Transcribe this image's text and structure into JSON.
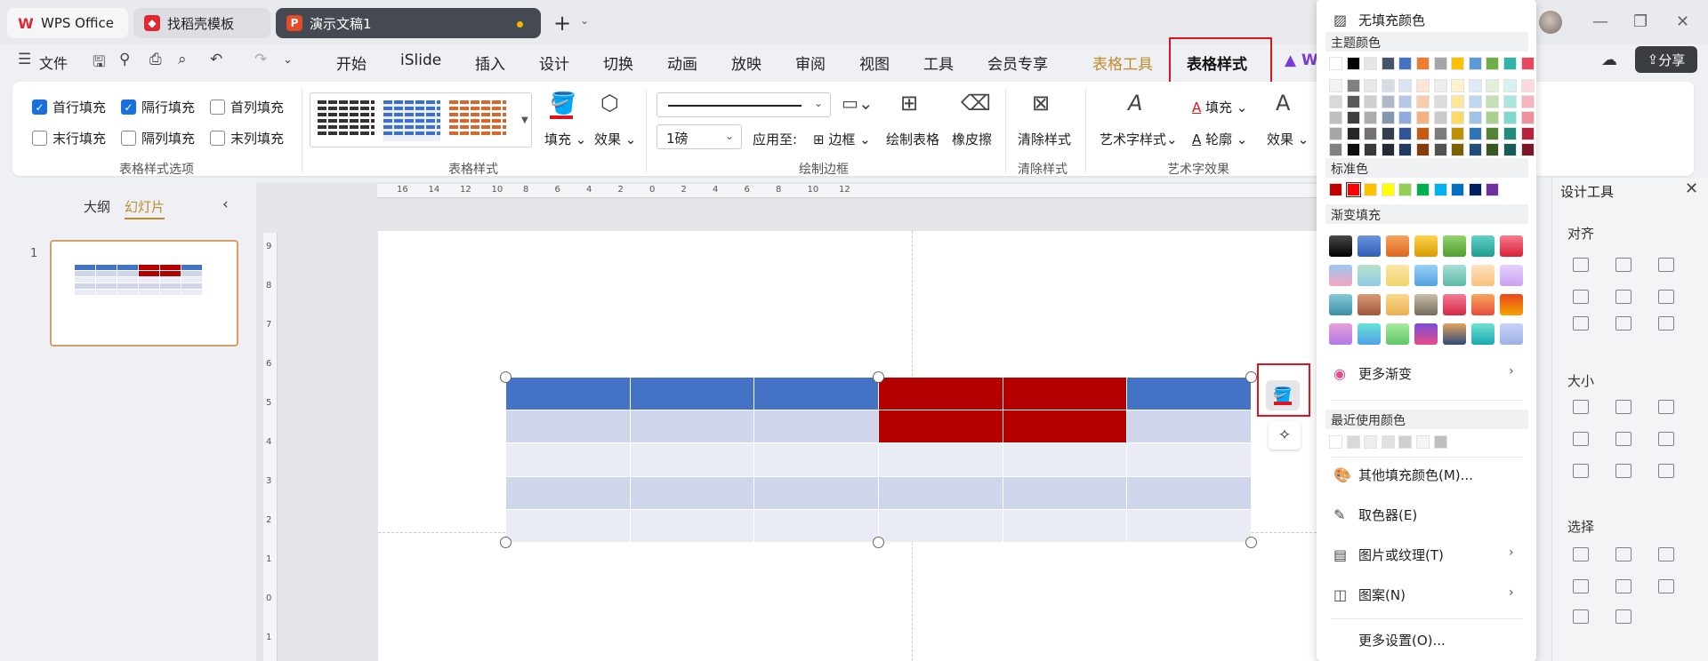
{
  "tabs": [
    {
      "label": "WPS Office",
      "icon": "wps-logo-icon"
    },
    {
      "label": "找稻壳模板",
      "icon": "docer-icon"
    },
    {
      "label": "演示文稿1",
      "icon": "presentation-icon",
      "active": true
    }
  ],
  "menu": {
    "file": "文件",
    "items": [
      "开始",
      "iSlide",
      "插入",
      "设计",
      "切换",
      "动画",
      "放映",
      "审阅",
      "视图",
      "工具",
      "会员专享",
      "表格工具",
      "表格样式",
      "W"
    ],
    "share": "分享"
  },
  "ribbon": {
    "options": {
      "first_row": "首行填充",
      "banded_rows": "隔行填充",
      "first_col": "首列填充",
      "last_row": "末行填充",
      "banded_cols": "隔列填充",
      "last_col": "末列填充",
      "first_row_checked": true,
      "banded_rows_checked": true,
      "group_label": "表格样式选项"
    },
    "styles": {
      "fill": "填充",
      "effect": "效果",
      "group_label": "表格样式"
    },
    "border": {
      "weight": "1磅",
      "apply_to": "应用至:",
      "border_btn": "边框",
      "draw_table": "绘制表格",
      "eraser": "橡皮擦",
      "group_label": "绘制边框"
    },
    "clear": {
      "clear_style": "清除样式",
      "group_label": "清除样式"
    },
    "art": {
      "art_style": "艺术字样式",
      "fill": "填充",
      "outline": "轮廓",
      "effect": "效果",
      "group_label": "艺术字效果"
    }
  },
  "left_panel": {
    "outline": "大纲",
    "slides": "幻灯片",
    "slide_number": "1"
  },
  "ruler": {
    "h_ticks": [
      "16",
      "14",
      "12",
      "10",
      "8",
      "6",
      "4",
      "2",
      "0",
      "2",
      "4",
      "6",
      "8",
      "10",
      "12"
    ],
    "v_ticks": [
      "9",
      "8",
      "7",
      "6",
      "5",
      "4",
      "3",
      "2",
      "1",
      "0",
      "1"
    ]
  },
  "table": {
    "rows": [
      [
        "#4472c4",
        "#4472c4",
        "#4472c4",
        "#b50000",
        "#b50000",
        "#4472c4"
      ],
      [
        "#cfd5ea",
        "#cfd5ea",
        "#cfd5ea",
        "#b50000",
        "#b50000",
        "#cfd5ea"
      ],
      [
        "#e9ebf5",
        "#e9ebf5",
        "#e9ebf5",
        "#e9ebf5",
        "#e9ebf5",
        "#e9ebf5"
      ],
      [
        "#cfd5ea",
        "#cfd5ea",
        "#cfd5ea",
        "#cfd5ea",
        "#cfd5ea",
        "#cfd5ea"
      ],
      [
        "#e9ebf5",
        "#e9ebf5",
        "#e9ebf5",
        "#e9ebf5",
        "#e9ebf5",
        "#e9ebf5"
      ]
    ]
  },
  "fill_menu": {
    "no_fill": "无填充颜色",
    "theme_colors": "主题颜色",
    "standard_colors": "标准色",
    "gradient_fill": "渐变填充",
    "more_gradient": "更多渐变",
    "recent_colors": "最近使用颜色",
    "more_colors": "其他填充颜色(M)...",
    "eyedropper": "取色器(E)",
    "picture_texture": "图片或纹理(T)",
    "pattern": "图案(N)",
    "more_settings": "更多设置(O)...",
    "theme_top": [
      "#ffffff",
      "#000000",
      "#e7e6e6",
      "#44546a",
      "#4472c4",
      "#ed7d31",
      "#a5a5a5",
      "#ffc000",
      "#5b9bd5",
      "#70ad47",
      "#2eb6a8",
      "#e7485f"
    ],
    "theme_cols": [
      [
        "#f2f2f2",
        "#d9d9d9",
        "#bfbfbf",
        "#a6a6a6",
        "#808080"
      ],
      [
        "#808080",
        "#595959",
        "#404040",
        "#262626",
        "#0d0d0d"
      ],
      [
        "#e8e8e8",
        "#d0cece",
        "#aeabab",
        "#757171",
        "#3b3838"
      ],
      [
        "#d6dce4",
        "#adb9ca",
        "#8497b0",
        "#333f4f",
        "#222a35"
      ],
      [
        "#dae3f3",
        "#b4c7e7",
        "#8faadc",
        "#2f5597",
        "#203864"
      ],
      [
        "#fbe5d6",
        "#f8cbad",
        "#f4b183",
        "#c55a11",
        "#843c0c"
      ],
      [
        "#ededed",
        "#dbdbdb",
        "#c9c9c9",
        "#7b7b7b",
        "#525252"
      ],
      [
        "#fff2cc",
        "#ffe699",
        "#ffd966",
        "#bf9000",
        "#7f6000"
      ],
      [
        "#deebf7",
        "#bdd7ee",
        "#9dc3e6",
        "#2e75b6",
        "#1f4e79"
      ],
      [
        "#e2f0d9",
        "#c5e0b4",
        "#a9d18e",
        "#548235",
        "#385723"
      ],
      [
        "#d5f2ee",
        "#abe5de",
        "#81d8cd",
        "#228b7e",
        "#175c54"
      ],
      [
        "#fadadf",
        "#f5b5bf",
        "#f1909f",
        "#b8213b",
        "#7a1627"
      ]
    ],
    "standard": [
      "#c00000",
      "#ff0000",
      "#ffc000",
      "#ffff00",
      "#92d050",
      "#00b050",
      "#00b0f0",
      "#0070c0",
      "#002060",
      "#7030a0"
    ],
    "gradients": [
      [
        "#000000,#4a4a4a",
        "#2f5cb8,#6b95de",
        "#e0661c,#f5a35e",
        "#d99b00,#ffd34d",
        "#4e9e2f,#93d36e",
        "#1e9a91,#62d1c6",
        "#d7203a,#f77b8d"
      ],
      [
        "#f6a5c0,#9cc7f2",
        "#8fc9e8,#b8e3c8",
        "#f4d36a,#f9e7a8",
        "#4fa3e0,#9ad0f5",
        "#5cb9a8,#a7e0d4",
        "#f9c27a,#fde2c0",
        "#c9a2f0,#e6d2fb"
      ],
      [
        "#3a8fa6,#86c8d6",
        "#a0573a,#d89b76",
        "#e9b04e,#fbd98c",
        "#756d5b,#c6bea9",
        "#d6284a,#f27c93",
        "#e94b3c,#f7a65a",
        "#f5a300,#e9471c"
      ],
      [
        "#b07ae8,#e7a0d8",
        "#4fa0e8,#66e3d8",
        "#5fc765,#a8ea9c",
        "#e84a8a,#7b4fd6",
        "#2e4a7a,#e3a25c",
        "#1aa8b0,#6fe2d1",
        "#9eb0e6,#c7d3f5"
      ]
    ],
    "recent": [
      "#ffffff",
      "#d9d9d9",
      "#ededed",
      "#e0e0e0",
      "#cfcfcf",
      "#f5f5f5",
      "#bfbfbf"
    ]
  },
  "design_panel": {
    "title": "设计工具",
    "align": "对齐",
    "size": "大小",
    "select": "选择"
  }
}
